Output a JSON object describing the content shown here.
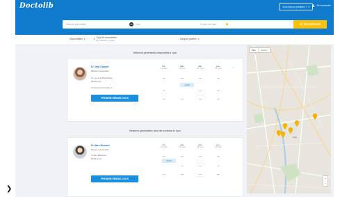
{
  "header": {
    "logo": "Doctolib",
    "pro_button": "Vous êtes un praticien ?",
    "pro_chevron": "▾",
    "login": "Se connecter",
    "login_icon": "user-icon"
  },
  "search": {
    "specialty_placeholder": "Médecin généraliste",
    "badge": "69",
    "city_value": "Lyon",
    "availability_placeholder": "Choisir une date",
    "button_label": "RECHERCHER",
    "button_icon": "search-icon",
    "pin_icon": "map-pin-icon"
  },
  "filters": [
    {
      "label": "Disponibilités",
      "chevron": "▾"
    },
    {
      "label": "Type de consultation",
      "sub": "En cabinet / en vidéo",
      "chevron": "▾"
    },
    {
      "label": "Langues parlées",
      "chevron": "▾"
    }
  ],
  "sections": [
    {
      "title": "Médecins généralistes disponibles à Lyon"
    },
    {
      "title": "Médecins généralistes dans les environs de Lyon"
    }
  ],
  "doctors": [
    {
      "name": "Dr Jean Dupont",
      "lines": [
        "Médecin généraliste",
        "12 rue de la République",
        "69002 Lyon"
      ],
      "distance": "Conventionné secteur 1",
      "book_label": "PRENDRE RENDEZ-VOUS",
      "days": [
        {
          "day": "lun.",
          "date": "12 mars"
        },
        {
          "day": "mar.",
          "date": "13 mars"
        },
        {
          "day": "mer.",
          "date": "14 mars"
        },
        {
          "day": "jeu.",
          "date": "15 mars"
        }
      ],
      "slot": "14:30"
    },
    {
      "name": "Dr Marc Bernard",
      "lines": [
        "Médecin généraliste",
        "5 place Bellecour",
        "69002 Lyon"
      ],
      "distance": "",
      "book_label": "PRENDRE RENDEZ-VOUS",
      "days": [
        {
          "day": "lun.",
          "date": "12 mars"
        },
        {
          "day": "mar.",
          "date": "13 mars"
        },
        {
          "day": "mer.",
          "date": "14 mars"
        },
        {
          "day": "jeu.",
          "date": "15 mars"
        }
      ],
      "slot": "09:00"
    }
  ],
  "map": {
    "tabs": [
      "Plan",
      "Satellite"
    ],
    "city_label": "Lyon",
    "zoom_in": "+",
    "zoom_out": "−",
    "pin_color": "#f5b400"
  },
  "colors": {
    "brand_blue": "#107acc",
    "accent_yellow": "#ffc107"
  },
  "stray_mark": "❯"
}
